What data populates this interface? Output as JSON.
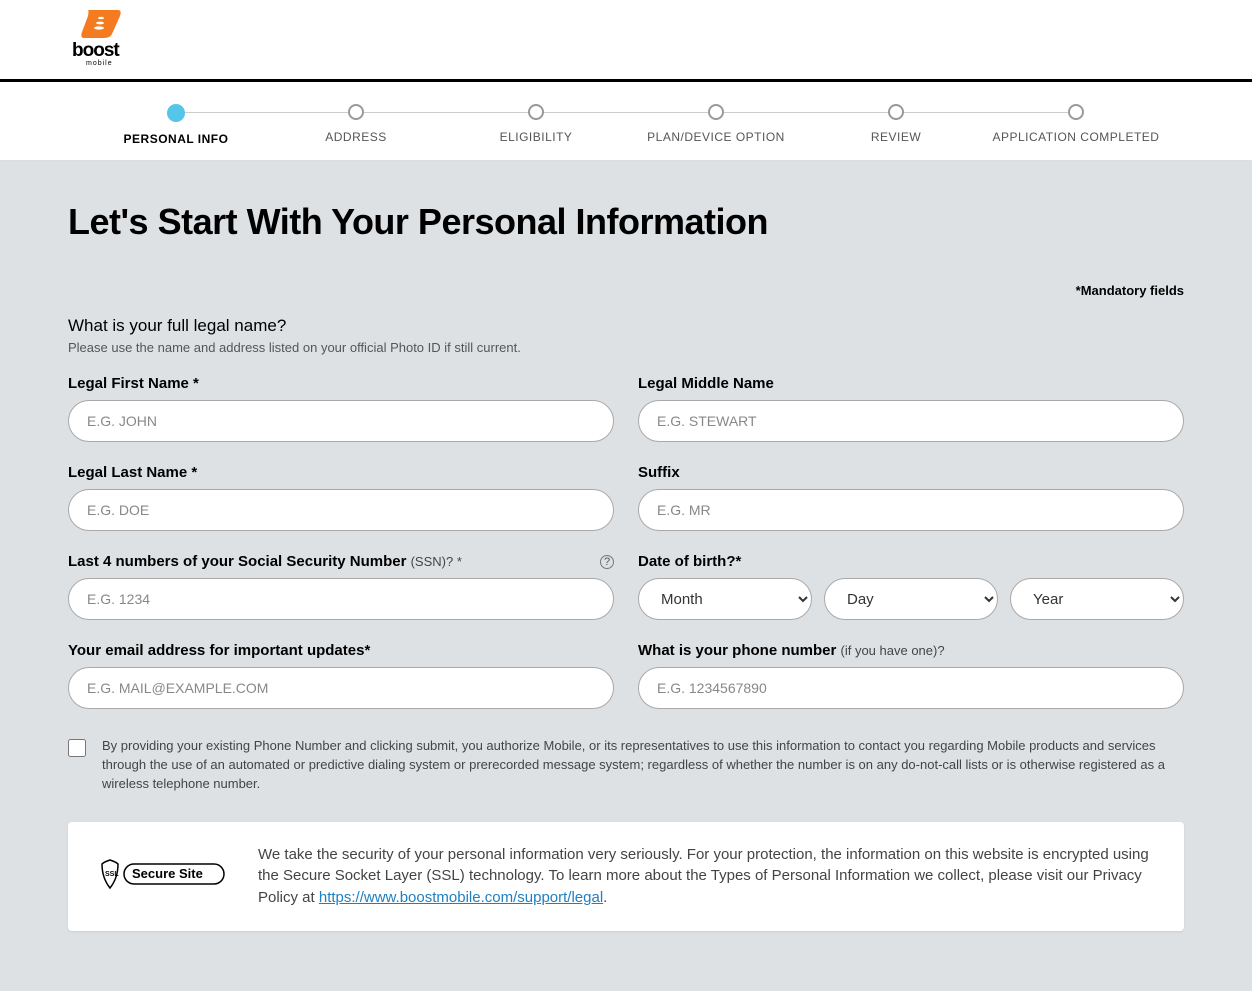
{
  "brand": {
    "name": "boost",
    "sub": "mobile"
  },
  "stepper": {
    "steps": [
      {
        "label": "PERSONAL INFO",
        "active": true
      },
      {
        "label": "ADDRESS",
        "active": false
      },
      {
        "label": "ELIGIBILITY",
        "active": false
      },
      {
        "label": "PLAN/DEVICE OPTION",
        "active": false
      },
      {
        "label": "REVIEW",
        "active": false
      },
      {
        "label": "APPLICATION COMPLETED",
        "active": false
      }
    ]
  },
  "page": {
    "title": "Let's Start With Your Personal Information",
    "mandatory_note": "*Mandatory fields",
    "name_question": "What is your full legal name?",
    "name_hint": "Please use the name and address listed on your official Photo ID if still current."
  },
  "fields": {
    "first_name": {
      "label": "Legal First Name *",
      "placeholder": "E.G. JOHN"
    },
    "middle_name": {
      "label": "Legal Middle Name",
      "placeholder": "E.G. STEWART"
    },
    "last_name": {
      "label": "Legal Last Name  *",
      "placeholder": "E.G. DOE"
    },
    "suffix": {
      "label": "Suffix",
      "placeholder": "E.G. MR"
    },
    "ssn": {
      "label": "Last 4 numbers of your Social Security Number ",
      "label_small": "(SSN)? *",
      "placeholder": "E.G. 1234"
    },
    "dob": {
      "label": "Date of birth?*",
      "month": "Month",
      "day": "Day",
      "year": "Year"
    },
    "email": {
      "label": "Your email address for important updates*",
      "placeholder": "E.G. MAIL@EXAMPLE.COM"
    },
    "phone": {
      "label": "What is your phone number ",
      "label_small": "(if you have one)?",
      "placeholder": "E.G. 1234567890"
    }
  },
  "consent": {
    "text": "By providing your existing Phone Number and clicking submit, you authorize Mobile, or its representatives to use this information to contact you regarding Mobile products and services through the use of an automated or predictive dialing system or prerecorded message system; regardless of whether the number is on any do-not-call lists or is otherwise registered as a wireless telephone number."
  },
  "security": {
    "badge_ssl": "SSL",
    "badge_text": "Secure Site",
    "text_prefix": "We take the security of your personal information very seriously. For your protection, the information on this website is encrypted using the Secure Socket Layer (SSL) technology. To learn more about the Types of Personal Information we collect, please visit our Privacy Policy at ",
    "link": "https://www.boostmobile.com/support/legal",
    "text_suffix": "."
  }
}
